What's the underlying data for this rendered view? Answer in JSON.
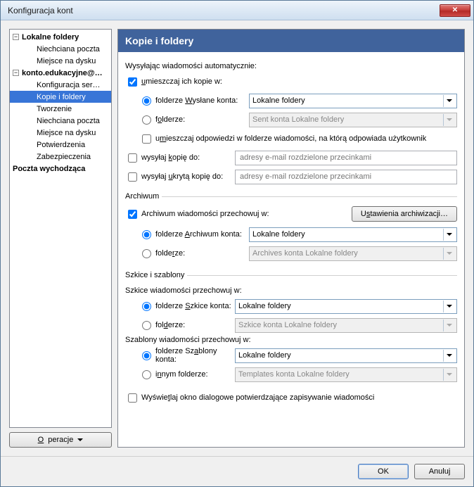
{
  "window": {
    "title": "Konfiguracja kont"
  },
  "tree": {
    "items": [
      {
        "label": "Lokalne foldery",
        "level": 0,
        "bold": true,
        "expander": "-",
        "selected": false
      },
      {
        "label": "Niechciana poczta",
        "level": 1,
        "bold": false,
        "selected": false
      },
      {
        "label": "Miejsce na dysku",
        "level": 1,
        "bold": false,
        "selected": false
      },
      {
        "label": "konto.edukacyjne@…",
        "level": 0,
        "bold": true,
        "expander": "-",
        "selected": false
      },
      {
        "label": "Konfiguracja ser…",
        "level": 1,
        "bold": false,
        "selected": false
      },
      {
        "label": "Kopie i foldery",
        "level": 1,
        "bold": false,
        "selected": true
      },
      {
        "label": "Tworzenie",
        "level": 1,
        "bold": false,
        "selected": false
      },
      {
        "label": "Niechciana poczta",
        "level": 1,
        "bold": false,
        "selected": false
      },
      {
        "label": "Miejsce na dysku",
        "level": 1,
        "bold": false,
        "selected": false
      },
      {
        "label": "Potwierdzenia",
        "level": 1,
        "bold": false,
        "selected": false
      },
      {
        "label": "Zabezpieczenia",
        "level": 1,
        "bold": false,
        "selected": false
      },
      {
        "label": "Poczta wychodząca",
        "level": 0,
        "bold": true,
        "selected": false
      }
    ],
    "operations_label": "Operacje"
  },
  "panel": {
    "title": "Kopie i foldery",
    "sending_header": "Wysyłając wiadomości automatycznie:",
    "place_copies_label": "umieszczaj ich kopie w:",
    "sent_folder_label_pre": "folderze ",
    "sent_folder_label_u": "W",
    "sent_folder_label_post": "ysłane konta:",
    "sent_value": "Lokalne foldery",
    "other_folder_label": "folderze:",
    "other_folder_value": "Sent konta Lokalne foldery",
    "place_replies_pre": "u",
    "place_replies_u": "m",
    "place_replies_post": "ieszczaj odpowiedzi w folderze wiadomości, na którą odpowiada użytkownik",
    "cc_label_pre": "wysyłaj ",
    "cc_label_u": "k",
    "cc_label_post": "opię do:",
    "cc_placeholder": "adresy e-mail rozdzielone przecinkami",
    "bcc_label_pre": "wysyłaj ",
    "bcc_label_u": "u",
    "bcc_label_post": "krytą kopię do:",
    "bcc_placeholder": "adresy e-mail rozdzielone przecinkami",
    "archive_legend": "Archiwum",
    "archive_keep_label": "Archiwum wiadomości przechowuj w:",
    "archive_settings_pre": "U",
    "archive_settings_u": "s",
    "archive_settings_post": "tawienia archiwizacji…",
    "archive_folder_label_pre": "folderze ",
    "archive_folder_label_u": "A",
    "archive_folder_label_post": "rchiwum konta:",
    "archive_value": "Lokalne foldery",
    "archive_other_label": "folderze:",
    "archive_other_value": "Archives konta Lokalne foldery",
    "drafts_legend": "Szkice i szablony",
    "drafts_header": "Szkice wiadomości przechowuj w:",
    "drafts_folder_label_pre": "folderze ",
    "drafts_folder_label_u": "S",
    "drafts_folder_label_post": "zkice konta:",
    "drafts_value": "Lokalne foldery",
    "drafts_other_label": "folderze:",
    "drafts_other_value": "Szkice konta Lokalne foldery",
    "templates_header": "Szablony wiadomości przechowuj w:",
    "templates_folder_label_pre": "folderze Sz",
    "templates_folder_label_u": "a",
    "templates_folder_label_post": "blony konta:",
    "templates_value": "Lokalne foldery",
    "templates_other_label_pre": "i",
    "templates_other_label_u": "n",
    "templates_other_label_post": "nym folderze:",
    "templates_other_value": "Templates konta Lokalne foldery",
    "confirm_dialog_pre": "Wyświe",
    "confirm_dialog_u": "t",
    "confirm_dialog_post": "laj okno dialogowe potwierdzające zapisywanie wiadomości"
  },
  "footer": {
    "ok": "OK",
    "cancel": "Anuluj"
  }
}
